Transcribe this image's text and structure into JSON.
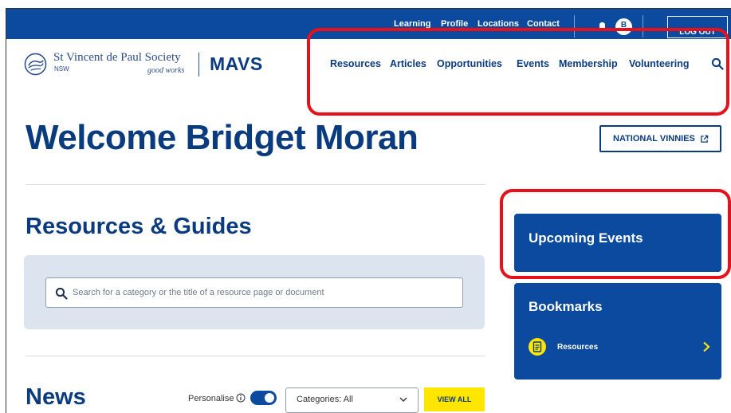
{
  "top_bar": {
    "links": [
      "Learning",
      "Profile",
      "Locations",
      "Contact"
    ],
    "avatar_initial": "B",
    "logout_label": "LOG OUT"
  },
  "logo": {
    "title": "St Vincent de Paul Society",
    "subtitle": "NSW",
    "tagline": "good works",
    "app_name": "MAVS"
  },
  "nav": {
    "items": [
      "Resources",
      "Articles",
      "Opportunities",
      "Events",
      "Membership",
      "Volunteering"
    ]
  },
  "header": {
    "welcome": "Welcome Bridget Moran",
    "national_button": "NATIONAL VINNIES"
  },
  "resources": {
    "title": "Resources & Guides",
    "search_placeholder": "Search for a category or the title of a resource page or document"
  },
  "news": {
    "title": "News",
    "personalise_label": "Personalise",
    "personalise_on": true,
    "category_select": "Categories: All",
    "view_all_label": "VIEW ALL"
  },
  "sidebar": {
    "events_title": "Upcoming Events",
    "bookmarks_title": "Bookmarks",
    "bookmark_items": [
      "Resources"
    ]
  },
  "colors": {
    "brand_blue": "#0b4a9e",
    "heading_navy": "#0b3b7f",
    "accent_yellow": "#ffe600",
    "annotation_red": "#e8101a"
  }
}
